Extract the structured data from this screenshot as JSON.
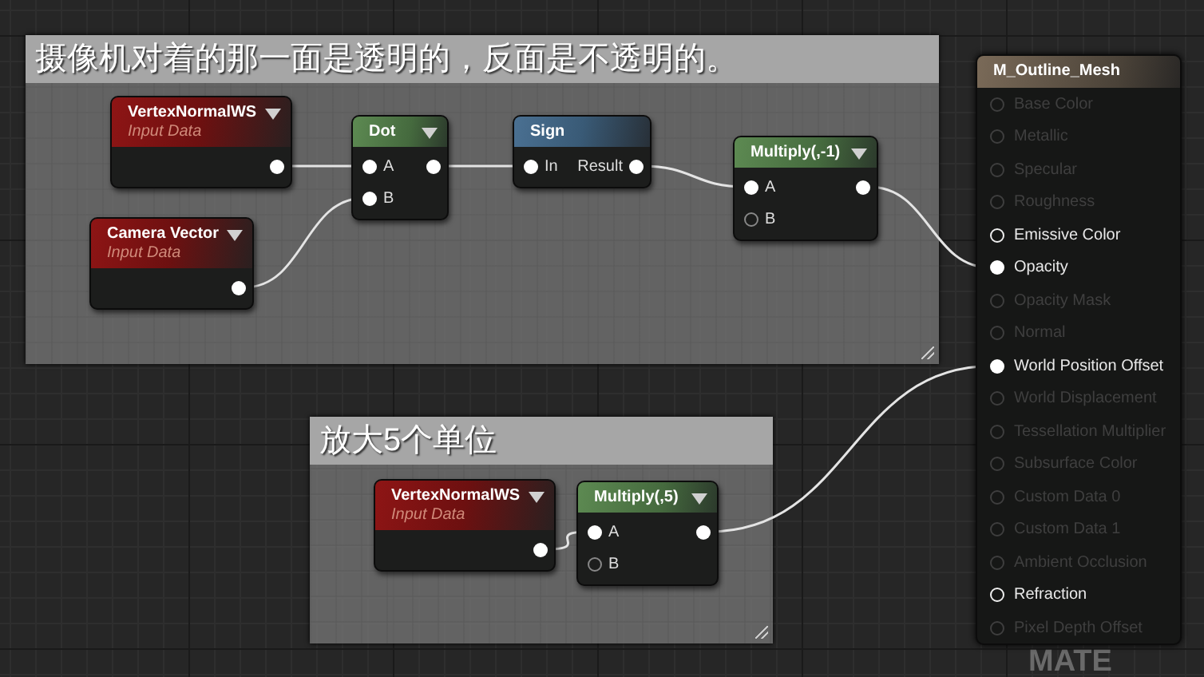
{
  "comments": [
    {
      "title": "摄像机对着的那一面是透明的，反面是不透明的。"
    },
    {
      "title": "放大5个单位"
    }
  ],
  "nodes": [
    {
      "kind": "input",
      "title": "VertexNormalWS",
      "subtitle": "Input Data",
      "menu_arrow": true,
      "output": {
        "connected": true
      }
    },
    {
      "kind": "input",
      "title": "Camera Vector",
      "subtitle": "Input Data",
      "menu_arrow": true,
      "output": {
        "connected": true
      }
    },
    {
      "kind": "math",
      "title": "Dot",
      "menu_arrow": true,
      "inputs": [
        {
          "label": "A",
          "connected": true
        },
        {
          "label": "B",
          "connected": true
        }
      ],
      "output": {
        "connected": true
      }
    },
    {
      "kind": "sign",
      "title": "Sign",
      "menu_arrow": false,
      "inputs": [
        {
          "label": "In",
          "connected": true
        }
      ],
      "output": {
        "label": "Result",
        "connected": true
      }
    },
    {
      "kind": "math",
      "title": "Multiply(,-1)",
      "menu_arrow": true,
      "inputs": [
        {
          "label": "A",
          "connected": true
        },
        {
          "label": "B",
          "connected": false
        }
      ],
      "output": {
        "connected": true
      }
    },
    {
      "kind": "input",
      "title": "VertexNormalWS",
      "subtitle": "Input Data",
      "menu_arrow": true,
      "output": {
        "connected": true
      }
    },
    {
      "kind": "math",
      "title": "Multiply(,5)",
      "menu_arrow": true,
      "inputs": [
        {
          "label": "A",
          "connected": true
        },
        {
          "label": "B",
          "connected": false
        }
      ],
      "output": {
        "connected": true
      }
    }
  ],
  "result": {
    "title": "M_Outline_Mesh",
    "pins": [
      {
        "label": "Base Color",
        "enabled": false,
        "connected": false
      },
      {
        "label": "Metallic",
        "enabled": false,
        "connected": false
      },
      {
        "label": "Specular",
        "enabled": false,
        "connected": false
      },
      {
        "label": "Roughness",
        "enabled": false,
        "connected": false
      },
      {
        "label": "Emissive Color",
        "enabled": true,
        "connected": false
      },
      {
        "label": "Opacity",
        "enabled": true,
        "connected": true
      },
      {
        "label": "Opacity Mask",
        "enabled": false,
        "connected": false
      },
      {
        "label": "Normal",
        "enabled": false,
        "connected": false
      },
      {
        "label": "World Position Offset",
        "enabled": true,
        "connected": true
      },
      {
        "label": "World Displacement",
        "enabled": false,
        "connected": false
      },
      {
        "label": "Tessellation Multiplier",
        "enabled": false,
        "connected": false
      },
      {
        "label": "Subsurface Color",
        "enabled": false,
        "connected": false
      },
      {
        "label": "Custom Data 0",
        "enabled": false,
        "connected": false
      },
      {
        "label": "Custom Data 1",
        "enabled": false,
        "connected": false
      },
      {
        "label": "Ambient Occlusion",
        "enabled": false,
        "connected": false
      },
      {
        "label": "Refraction",
        "enabled": true,
        "connected": false
      },
      {
        "label": "Pixel Depth Offset",
        "enabled": false,
        "connected": false
      }
    ]
  },
  "graph_watermark": "MATE"
}
